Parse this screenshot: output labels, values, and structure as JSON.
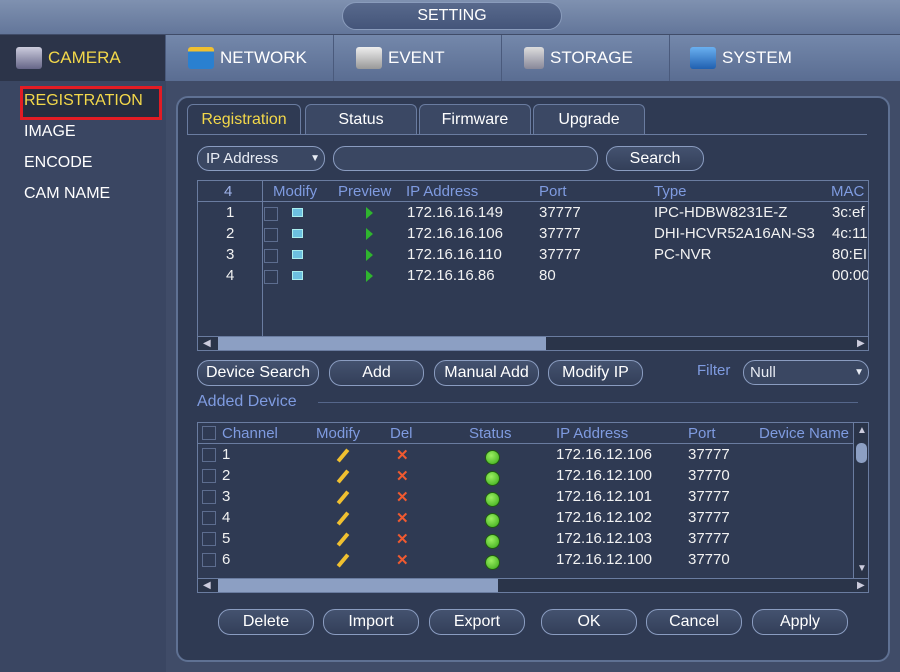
{
  "window": {
    "title": "SETTING"
  },
  "nav": [
    {
      "label": "CAMERA",
      "icon": "camera-icon"
    },
    {
      "label": "NETWORK",
      "icon": "network-icon"
    },
    {
      "label": "EVENT",
      "icon": "event-icon"
    },
    {
      "label": "STORAGE",
      "icon": "storage-icon"
    },
    {
      "label": "SYSTEM",
      "icon": "system-icon"
    }
  ],
  "sidebar": {
    "items": [
      {
        "label": "REGISTRATION"
      },
      {
        "label": "IMAGE"
      },
      {
        "label": "ENCODE"
      },
      {
        "label": "CAM NAME"
      }
    ]
  },
  "tabs": [
    {
      "label": "Registration"
    },
    {
      "label": "Status"
    },
    {
      "label": "Firmware"
    },
    {
      "label": "Upgrade"
    }
  ],
  "search": {
    "type_value": "IP Address",
    "input_value": "",
    "button": "Search"
  },
  "device_table": {
    "count": "4",
    "headers": [
      "Modify",
      "Preview",
      "IP Address",
      "Port",
      "Type",
      "MAC"
    ],
    "rows": [
      {
        "no": "1",
        "ip": "172.16.16.149",
        "port": "37777",
        "type": "IPC-HDBW8231E-Z",
        "mac": "3c:ef"
      },
      {
        "no": "2",
        "ip": "172.16.16.106",
        "port": "37777",
        "type": "DHI-HCVR52A16AN-S3",
        "mac": "4c:11"
      },
      {
        "no": "3",
        "ip": "172.16.16.110",
        "port": "37777",
        "type": "PC-NVR",
        "mac": "80:EI"
      },
      {
        "no": "4",
        "ip": "172.16.16.86",
        "port": "80",
        "type": "",
        "mac": "00:00"
      }
    ]
  },
  "actions": {
    "device_search": "Device Search",
    "add": "Add",
    "manual_add": "Manual Add",
    "modify_ip": "Modify IP",
    "filter_label": "Filter",
    "filter_value": "Null"
  },
  "added": {
    "label": "Added Device",
    "headers": [
      "Channel",
      "Modify",
      "Del",
      "Status",
      "IP Address",
      "Port",
      "Device Name"
    ],
    "rows": [
      {
        "ch": "1",
        "ip": "172.16.12.106",
        "port": "37777",
        "status": "online"
      },
      {
        "ch": "2",
        "ip": "172.16.12.100",
        "port": "37770",
        "status": "online"
      },
      {
        "ch": "3",
        "ip": "172.16.12.101",
        "port": "37777",
        "status": "online"
      },
      {
        "ch": "4",
        "ip": "172.16.12.102",
        "port": "37777",
        "status": "online"
      },
      {
        "ch": "5",
        "ip": "172.16.12.103",
        "port": "37777",
        "status": "online"
      },
      {
        "ch": "6",
        "ip": "172.16.12.100",
        "port": "37770",
        "status": "online"
      }
    ]
  },
  "footer": {
    "delete": "Delete",
    "import": "Import",
    "export": "Export",
    "ok": "OK",
    "cancel": "Cancel",
    "apply": "Apply"
  },
  "colors": {
    "accent": "#f3d84a",
    "highlight_box": "#e21c24",
    "header_text": "#7f9be0",
    "status_online": "#4cc020"
  }
}
